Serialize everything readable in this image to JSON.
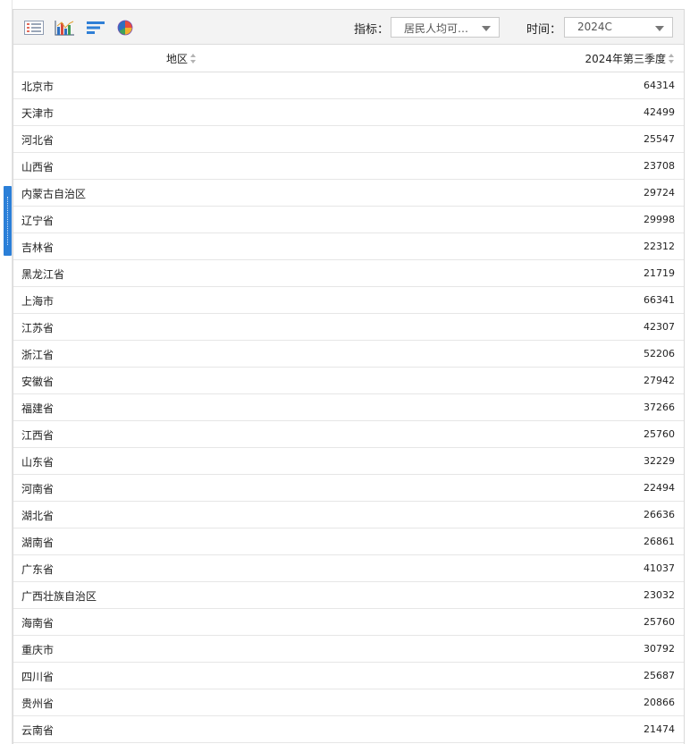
{
  "toolbar": {
    "tools": [
      "table-view-icon",
      "bar-chart-icon",
      "horizontal-bar-chart-icon",
      "pie-chart-icon"
    ],
    "indicator_label": "指标：",
    "indicator_value": "居民人均可…",
    "time_label": "时间：",
    "time_value": "2024C"
  },
  "colors": {
    "accent": "#2b7fd8",
    "toolbar_bg": "#f3f3f3",
    "border": "#d9d9d9"
  },
  "table": {
    "headers": [
      "地区",
      "2024年第三季度"
    ],
    "rows": [
      {
        "region": "北京市",
        "value": "64314"
      },
      {
        "region": "天津市",
        "value": "42499"
      },
      {
        "region": "河北省",
        "value": "25547"
      },
      {
        "region": "山西省",
        "value": "23708"
      },
      {
        "region": "内蒙古自治区",
        "value": "29724"
      },
      {
        "region": "辽宁省",
        "value": "29998"
      },
      {
        "region": "吉林省",
        "value": "22312"
      },
      {
        "region": "黑龙江省",
        "value": "21719"
      },
      {
        "region": "上海市",
        "value": "66341"
      },
      {
        "region": "江苏省",
        "value": "42307"
      },
      {
        "region": "浙江省",
        "value": "52206"
      },
      {
        "region": "安徽省",
        "value": "27942"
      },
      {
        "region": "福建省",
        "value": "37266"
      },
      {
        "region": "江西省",
        "value": "25760"
      },
      {
        "region": "山东省",
        "value": "32229"
      },
      {
        "region": "河南省",
        "value": "22494"
      },
      {
        "region": "湖北省",
        "value": "26636"
      },
      {
        "region": "湖南省",
        "value": "26861"
      },
      {
        "region": "广东省",
        "value": "41037"
      },
      {
        "region": "广西壮族自治区",
        "value": "23032"
      },
      {
        "region": "海南省",
        "value": "25760"
      },
      {
        "region": "重庆市",
        "value": "30792"
      },
      {
        "region": "四川省",
        "value": "25687"
      },
      {
        "region": "贵州省",
        "value": "20866"
      },
      {
        "region": "云南省",
        "value": "21474"
      }
    ]
  }
}
